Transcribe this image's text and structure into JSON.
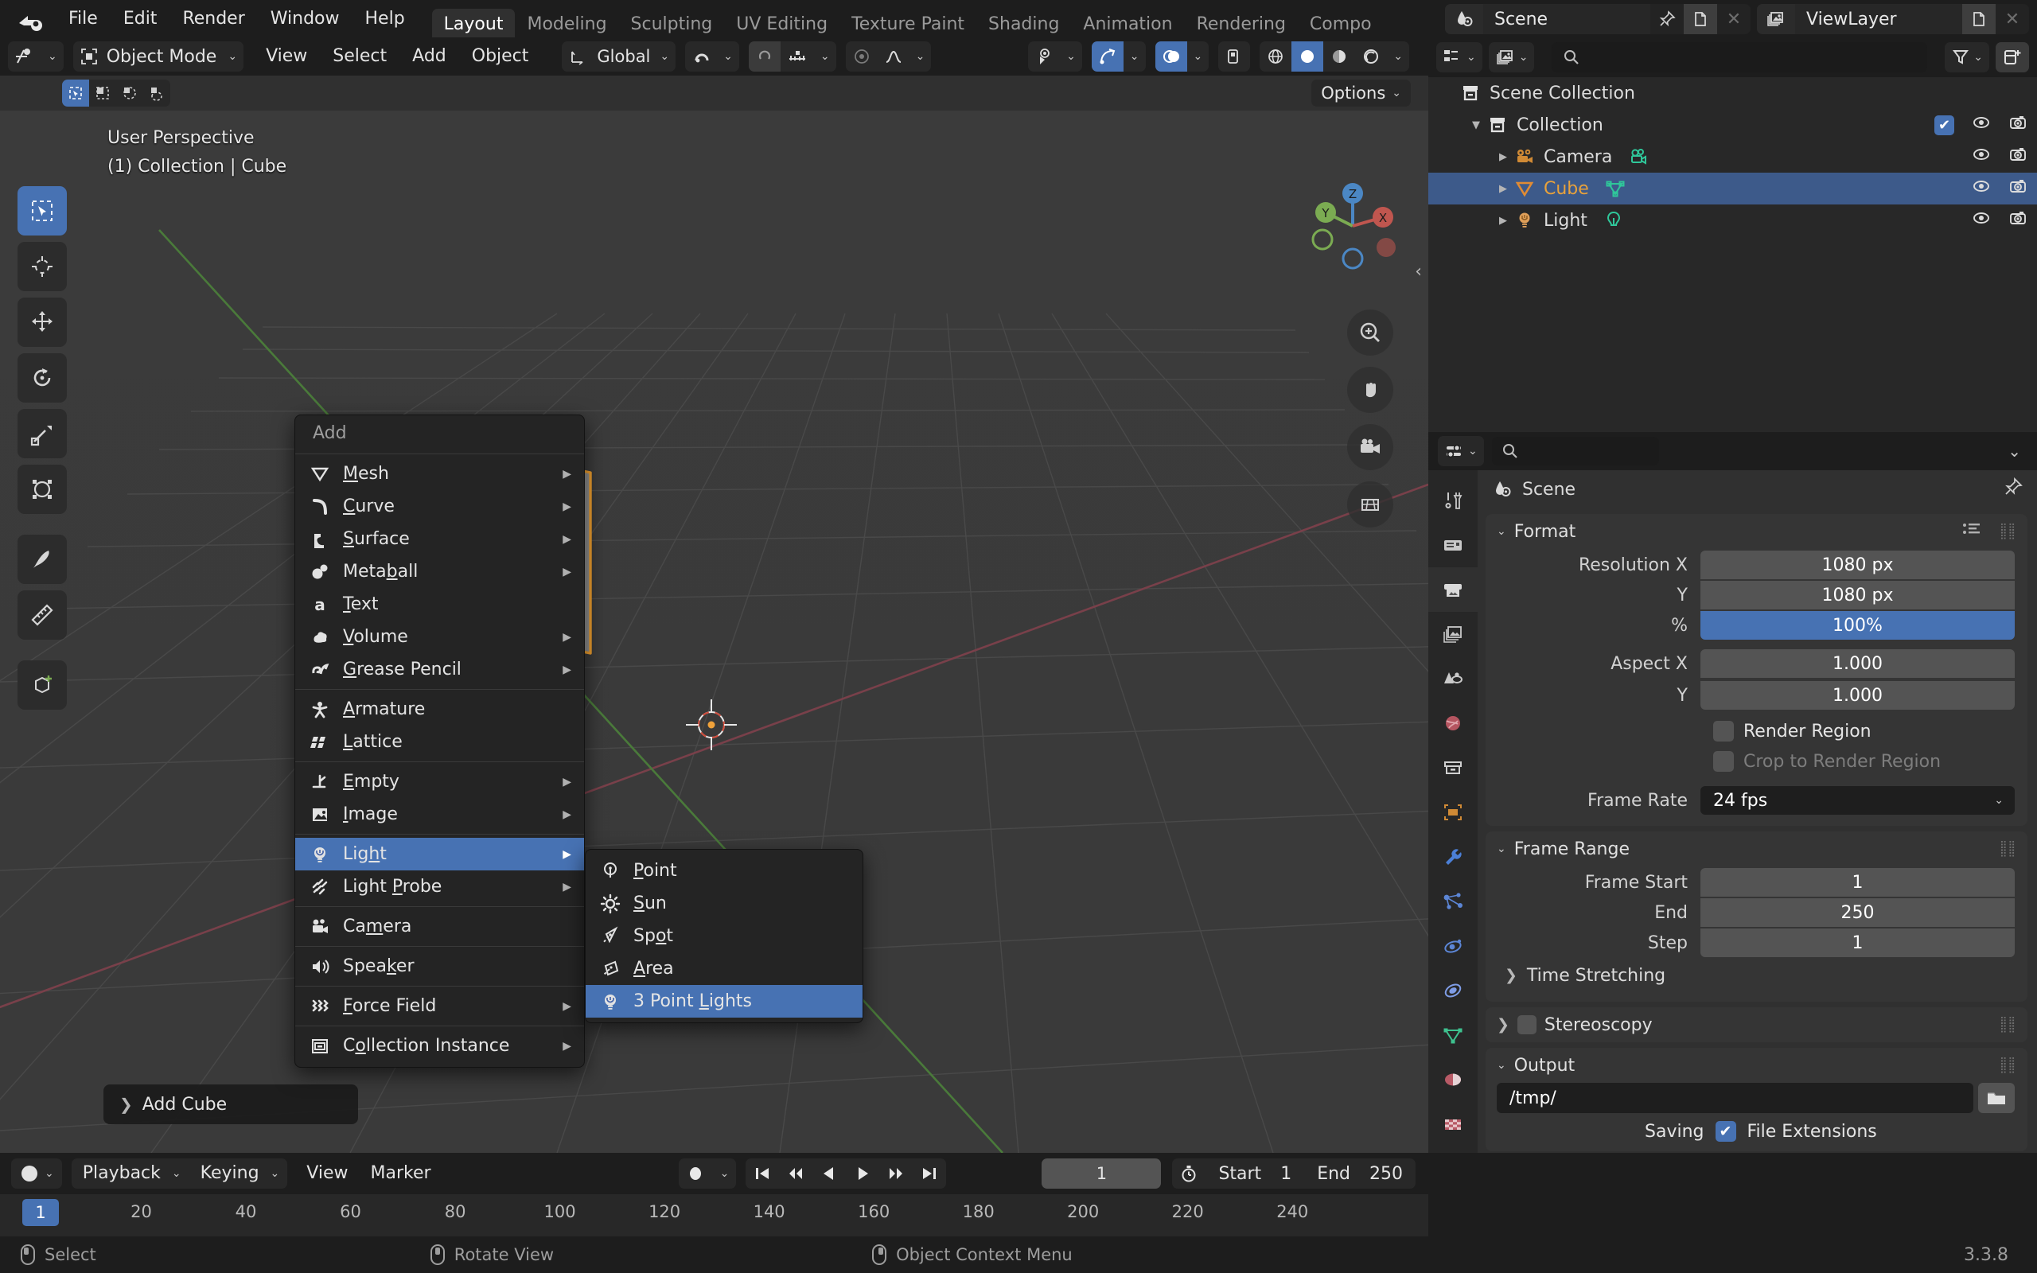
{
  "app": {
    "logo_icon": "blender-logo",
    "version": "3.3.8",
    "menus": [
      "File",
      "Edit",
      "Render",
      "Window",
      "Help"
    ],
    "workspace_tabs": [
      "Layout",
      "Modeling",
      "Sculpting",
      "UV Editing",
      "Texture Paint",
      "Shading",
      "Animation",
      "Rendering",
      "Compo"
    ],
    "active_workspace": "Layout",
    "scene": {
      "label": "Scene",
      "icon": "scene-icon",
      "pin_icon": "pin-icon",
      "copy_icon": "new-scene-icon",
      "close_icon": "x-icon"
    },
    "view_layer": {
      "label": "ViewLayer",
      "icon": "viewlayer-icon",
      "copy_icon": "new-viewlayer-icon",
      "close_icon": "x-icon"
    }
  },
  "viewport": {
    "header": {
      "editor_icon": "editor-type-icon",
      "mode": "Object Mode",
      "mode_icon": "object-mode-icon",
      "menus": [
        "View",
        "Select",
        "Add",
        "Object"
      ],
      "transform_orientation": "Global",
      "orientation_icon": "orientation-icon",
      "snap_icon": "magnet-icon",
      "snap_target_icon": "snap-increment-icon",
      "proportional_icon": "proportional-edit-icon",
      "falloff_icon": "falloff-smooth-icon",
      "visibility_icon": "visibility-eye-icon",
      "gizmo_icon": "gizmo-icon",
      "overlays_icon": "overlays-icon",
      "xray_icon": "xray-icon",
      "shading_wireframe_icon": "shading-wireframe",
      "shading_solid_icon": "shading-solid",
      "shading_material_icon": "shading-material",
      "shading_rendered_icon": "shading-rendered"
    },
    "subheader": {
      "select_modes": [
        "tweak-select",
        "box-select",
        "circle-select",
        "lasso-select"
      ],
      "options_label": "Options"
    },
    "overlay_text": {
      "perspective": "User Perspective",
      "scene_info": "(1) Collection | Cube"
    },
    "toolbar": [
      {
        "name": "tweak-tool",
        "active": true
      },
      {
        "name": "cursor-tool",
        "active": false
      },
      {
        "name": "move-tool",
        "active": false
      },
      {
        "name": "rotate-tool",
        "active": false
      },
      {
        "name": "scale-tool",
        "active": false
      },
      {
        "name": "transform-tool",
        "active": false
      },
      {
        "name": "annotate-tool",
        "active": false
      },
      {
        "name": "measure-tool",
        "active": false
      },
      {
        "name": "add-cube-tool",
        "active": false
      }
    ],
    "nav_gizmo": {
      "axes": [
        "X",
        "Y",
        "Z"
      ]
    },
    "nav_buttons": [
      "zoom-icon",
      "pan-hand-icon",
      "camera-view-icon",
      "ortho-toggle-icon"
    ],
    "operator_panel": {
      "label": "Add Cube",
      "expand_icon": "chevron-right-icon"
    }
  },
  "add_menu": {
    "title": "Add",
    "groups": [
      [
        {
          "label": "Mesh",
          "icon": "mesh-icon",
          "submenu": true,
          "underline": "M"
        },
        {
          "label": "Curve",
          "icon": "curve-icon",
          "submenu": true,
          "underline": "C"
        },
        {
          "label": "Surface",
          "icon": "surface-icon",
          "submenu": true,
          "underline": "S"
        },
        {
          "label": "Metaball",
          "icon": "metaball-icon",
          "submenu": true,
          "underline": "b"
        },
        {
          "label": "Text",
          "icon": "text-icon",
          "submenu": false,
          "underline": "T"
        },
        {
          "label": "Volume",
          "icon": "volume-icon",
          "submenu": true,
          "underline": "V"
        },
        {
          "label": "Grease Pencil",
          "icon": "grease-pencil-icon",
          "submenu": true,
          "underline": "G"
        }
      ],
      [
        {
          "label": "Armature",
          "icon": "armature-icon",
          "submenu": false,
          "underline": "A"
        },
        {
          "label": "Lattice",
          "icon": "lattice-icon",
          "submenu": false,
          "underline": "L"
        }
      ],
      [
        {
          "label": "Empty",
          "icon": "empty-icon",
          "submenu": true,
          "underline": "E"
        },
        {
          "label": "Image",
          "icon": "image-icon",
          "submenu": true,
          "underline": "I"
        }
      ],
      [
        {
          "label": "Light",
          "icon": "light-icon",
          "submenu": true,
          "underline": "h",
          "selected": true
        },
        {
          "label": "Light Probe",
          "icon": "light-probe-icon",
          "submenu": true,
          "underline": "P"
        }
      ],
      [
        {
          "label": "Camera",
          "icon": "camera-icon",
          "submenu": false,
          "underline": "m"
        }
      ],
      [
        {
          "label": "Speaker",
          "icon": "speaker-icon",
          "submenu": false,
          "underline": "k"
        }
      ],
      [
        {
          "label": "Force Field",
          "icon": "force-field-icon",
          "submenu": true,
          "underline": "F"
        }
      ],
      [
        {
          "label": "Collection Instance",
          "icon": "collection-instance-icon",
          "submenu": true,
          "underline": "o"
        }
      ]
    ]
  },
  "light_submenu": {
    "items": [
      {
        "label": "Point",
        "icon": "light-point-icon",
        "selected": false,
        "underline": "P"
      },
      {
        "label": "Sun",
        "icon": "light-sun-icon",
        "selected": false,
        "underline": "S"
      },
      {
        "label": "Spot",
        "icon": "light-spot-icon",
        "selected": false,
        "underline": "o"
      },
      {
        "label": "Area",
        "icon": "light-area-icon",
        "selected": false,
        "underline": "A"
      },
      {
        "label": "3 Point Lights",
        "icon": "light-icon",
        "selected": true,
        "underline": "L"
      }
    ]
  },
  "outliner": {
    "header": {
      "display_mode_icon": "outliner-display-icon",
      "filter_id_icon": "filter-id-icon",
      "search_icon": "search-icon",
      "search_value": "",
      "filter_icon": "funnel-icon",
      "new_collection_icon": "new-collection-icon"
    },
    "rows": [
      {
        "label": "Scene Collection",
        "icon": "scene-collection-icon",
        "indent": 0,
        "expand": "",
        "selected": false,
        "checkbox": false,
        "eye": false,
        "camera": false
      },
      {
        "label": "Collection",
        "icon": "collection-icon",
        "indent": 1,
        "expand": "down",
        "selected": false,
        "checkbox": true,
        "eye": true,
        "camera": true
      },
      {
        "label": "Camera",
        "icon": "camera-obj-icon",
        "indent": 2,
        "expand": "right",
        "selected": false,
        "checkbox": false,
        "eye": true,
        "camera": true,
        "data_icon": "camera-data-icon"
      },
      {
        "label": "Cube",
        "icon": "mesh-obj-icon",
        "indent": 2,
        "expand": "right",
        "selected": true,
        "checkbox": false,
        "eye": true,
        "camera": true,
        "data_icon": "mesh-data-icon"
      },
      {
        "label": "Light",
        "icon": "light-obj-icon",
        "indent": 2,
        "expand": "right",
        "selected": false,
        "checkbox": false,
        "eye": true,
        "camera": true,
        "data_icon": "light-data-icon"
      }
    ]
  },
  "properties": {
    "header": {
      "editor_icon": "properties-editor-icon",
      "search_value": "",
      "search_icon": "search-icon",
      "expand_icon": "chevron-down-icon"
    },
    "tabs": [
      {
        "name": "tool-tab",
        "icon": "tool-icon",
        "active": false
      },
      {
        "name": "render-tab",
        "icon": "render-icon",
        "active": false
      },
      {
        "name": "output-tab",
        "icon": "printer-icon",
        "active": true
      },
      {
        "name": "viewlayer-tab",
        "icon": "images-icon",
        "active": false
      },
      {
        "name": "scene-tab",
        "icon": "scene-cone-icon",
        "active": false
      },
      {
        "name": "world-tab",
        "icon": "world-icon",
        "active": false
      },
      {
        "name": "collection-tab",
        "icon": "box-icon",
        "active": false
      },
      {
        "name": "object-tab",
        "icon": "object-orange-icon",
        "active": false
      },
      {
        "name": "modifier-tab",
        "icon": "wrench-icon",
        "active": false
      },
      {
        "name": "particles-tab",
        "icon": "particles-icon",
        "active": false
      },
      {
        "name": "physics-tab",
        "icon": "physics-icon",
        "active": false
      },
      {
        "name": "constraints-tab",
        "icon": "constraints-icon",
        "active": false
      },
      {
        "name": "data-tab",
        "icon": "mesh-data-green-icon",
        "active": false
      },
      {
        "name": "material-tab",
        "icon": "material-sphere-icon",
        "active": false
      },
      {
        "name": "texture-tab",
        "icon": "checker-icon",
        "active": false
      }
    ],
    "breadcrumb": {
      "icon": "output-icon",
      "label": "Scene",
      "pin_icon": "pin-icon"
    },
    "panels": [
      {
        "title": "Format",
        "open": true,
        "header_icons": [
          "presets-icon",
          "grip-icon"
        ],
        "rows": [
          {
            "label": "Resolution X",
            "value": "1080 px",
            "style": "top"
          },
          {
            "label": "Y",
            "value": "1080 px",
            "style": "mid"
          },
          {
            "label": "%",
            "value": "100%",
            "style": "bot-blue"
          },
          {
            "label": "Aspect X",
            "value": "1.000",
            "style": "top"
          },
          {
            "label": "Y",
            "value": "1.000",
            "style": "bot"
          }
        ],
        "checks": [
          {
            "label": "Render Region",
            "checked": false,
            "disabled": false
          },
          {
            "label": "Crop to Render Region",
            "checked": false,
            "disabled": true
          }
        ],
        "dropdown": {
          "label": "Frame Rate",
          "value": "24 fps",
          "chevron": "chevron-down-icon"
        }
      },
      {
        "title": "Frame Range",
        "open": true,
        "header_icons": [
          "grip-icon"
        ],
        "rows": [
          {
            "label": "Frame Start",
            "value": "1",
            "style": "top"
          },
          {
            "label": "End",
            "value": "250",
            "style": "mid"
          },
          {
            "label": "Step",
            "value": "1",
            "style": "bot"
          }
        ],
        "sub": {
          "label": "Time Stretching",
          "open": false
        }
      },
      {
        "title": "Stereoscopy",
        "open": false,
        "checkbox": false,
        "header_icons": [
          "grip-icon"
        ]
      },
      {
        "title": "Output",
        "open": true,
        "header_icons": [
          "grip-icon"
        ],
        "path_value": "/tmp/",
        "folder_icon": "folder-icon",
        "saving_label": "Saving",
        "file_ext_label": "File Extensions",
        "file_ext_checked": true
      }
    ]
  },
  "timeline": {
    "header": {
      "editor_icon": "timeline-editor-icon",
      "menus": [
        "Playback",
        "Keying",
        "View",
        "Marker"
      ],
      "record_icon": "record-icon",
      "transport": [
        "jump-start-icon",
        "prev-keyframe-icon",
        "play-reverse-icon",
        "play-icon",
        "next-keyframe-icon",
        "jump-end-icon"
      ],
      "current_frame": "1",
      "stopwatch_icon": "stopwatch-icon",
      "start_label": "Start",
      "start_value": "1",
      "end_label": "End",
      "end_value": "250"
    },
    "ticks": [
      20,
      40,
      60,
      80,
      100,
      120,
      140,
      160,
      180,
      200,
      220,
      240
    ],
    "playhead_frame": "1"
  },
  "statusbar": {
    "items": [
      {
        "icon": "mouse-left-icon",
        "label": "Select"
      },
      {
        "icon": "mouse-middle-icon",
        "label": "Rotate View"
      },
      {
        "icon": "mouse-right-icon",
        "label": "Object Context Menu"
      }
    ],
    "version": "3.3.8"
  }
}
